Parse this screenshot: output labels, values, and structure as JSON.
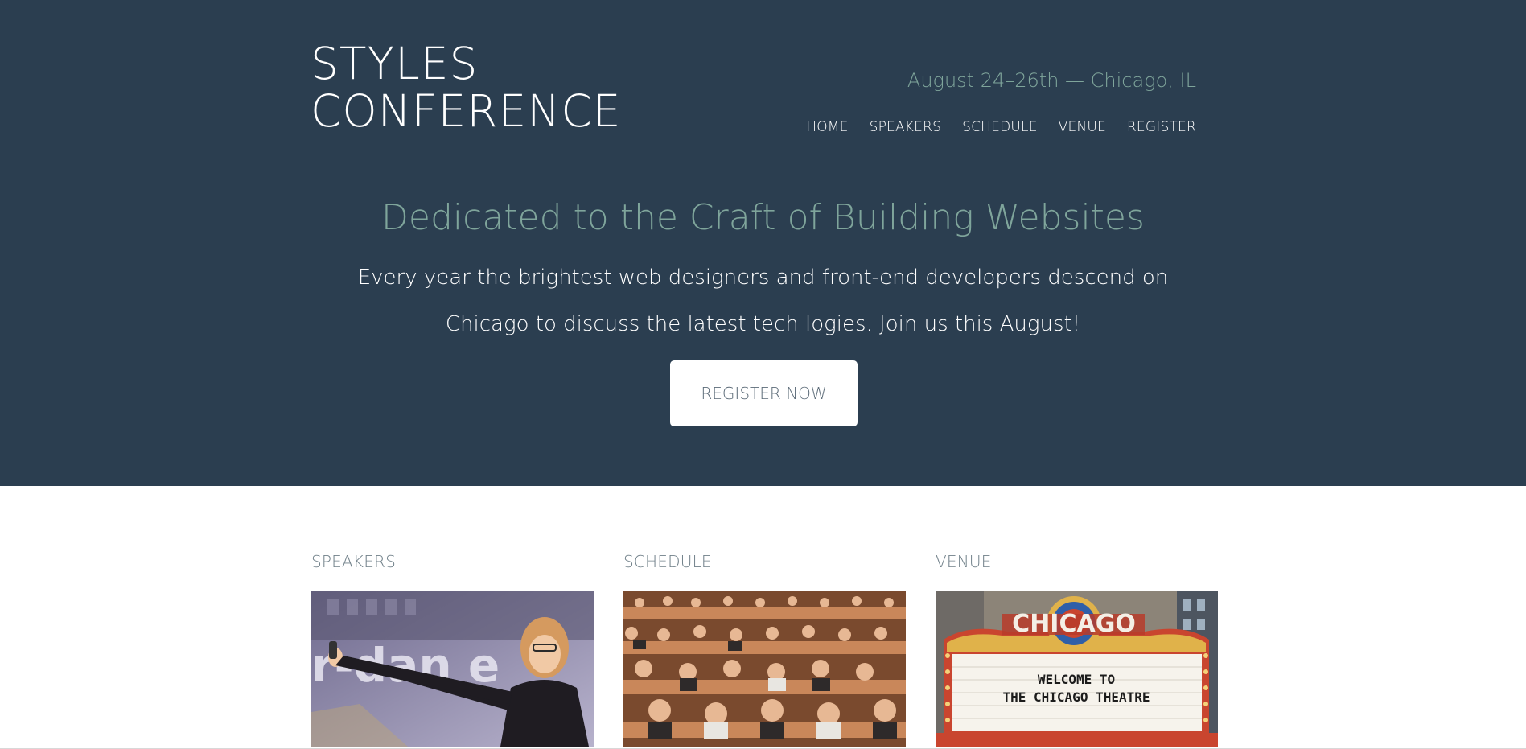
{
  "header": {
    "logo_line1": "STYLES",
    "logo_line2": "CONFERENCE",
    "tagline": "August 24–26th — Chicago, IL",
    "nav": [
      {
        "label": "HOME"
      },
      {
        "label": "SPEAKERS"
      },
      {
        "label": "SCHEDULE"
      },
      {
        "label": "VENUE"
      },
      {
        "label": "REGISTER"
      }
    ]
  },
  "hero": {
    "headline": "Dedicated to the Craft of Building Websites",
    "lead_line1": "Every year the brightest web designers and front-end developers descend on",
    "lead_line2": "Chicago to discuss the latest tech logies. Join us this August!",
    "cta_label": "REGISTER NOW"
  },
  "features": [
    {
      "title": "SPEAKERS",
      "image": "speaker-photo"
    },
    {
      "title": "SCHEDULE",
      "image": "audience-photo"
    },
    {
      "title": "VENUE",
      "image": "chicago-theatre-photo",
      "marquee_top": "CHICAGO",
      "marquee_line1": "WELCOME TO",
      "marquee_line2": "THE CHICAGO THEATRE"
    }
  ],
  "colors": {
    "hero_bg": "#2b3e50",
    "accent": "#7fa59b",
    "text_light": "#ffffff",
    "section_title": "#6f7f88"
  }
}
